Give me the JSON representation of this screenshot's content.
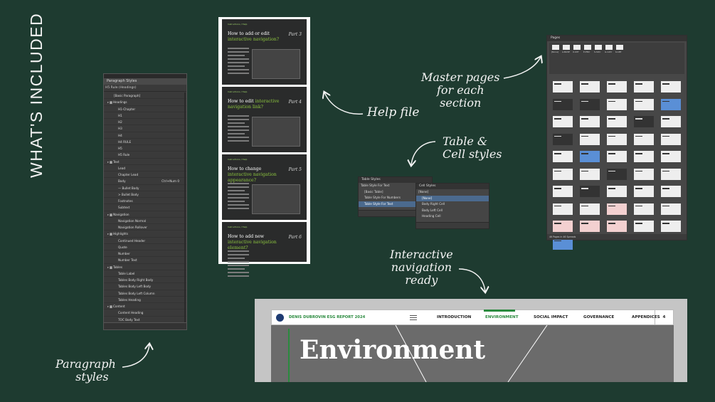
{
  "title": "WHAT'S INCLUDED",
  "annotations": {
    "paragraph": [
      "Paragraph",
      "styles"
    ],
    "help": "Help file",
    "table": [
      "Table &",
      "Cell styles"
    ],
    "master": [
      "Master pages",
      "for each",
      "section"
    ],
    "nav": [
      "Interactive",
      "navigation",
      "ready"
    ]
  },
  "paragraph_panel": {
    "title": "Paragraph Styles",
    "current": "H5 Rule (Headings)",
    "items": [
      {
        "label": "[Basic Paragraph]",
        "level": 1
      },
      {
        "label": "Headings",
        "level": 0
      },
      {
        "label": "H1-Chapter",
        "level": 2
      },
      {
        "label": "H1",
        "level": 2
      },
      {
        "label": "H2",
        "level": 2
      },
      {
        "label": "H3",
        "level": 2
      },
      {
        "label": "H4",
        "level": 2
      },
      {
        "label": "H4 RULE",
        "level": 2
      },
      {
        "label": "H5",
        "level": 2
      },
      {
        "label": "H5 Rule",
        "level": 2
      },
      {
        "label": "Text",
        "level": 0
      },
      {
        "label": "Lead",
        "level": 2
      },
      {
        "label": "Chapter Lead",
        "level": 2
      },
      {
        "label": "Body",
        "level": 2,
        "shortcut": "Ctrl+Num 0"
      },
      {
        "label": "— Bullet Body",
        "level": 2
      },
      {
        "label": "> Bullet Body",
        "level": 2
      },
      {
        "label": "Footnotes",
        "level": 2
      },
      {
        "label": "Subtext",
        "level": 2
      },
      {
        "label": "Navigation",
        "level": 0
      },
      {
        "label": "Navigation Normal",
        "level": 2
      },
      {
        "label": "Navigation Rollover",
        "level": 2
      },
      {
        "label": "Highlights",
        "level": 0
      },
      {
        "label": "Continued Header",
        "level": 2
      },
      {
        "label": "Quote",
        "level": 2
      },
      {
        "label": "Number",
        "level": 2
      },
      {
        "label": "Number Text",
        "level": 2
      },
      {
        "label": "Tables",
        "level": 0
      },
      {
        "label": "Table Label",
        "level": 2
      },
      {
        "label": "Tables Body Right Body",
        "level": 2
      },
      {
        "label": "Tables Body Left Body",
        "level": 2
      },
      {
        "label": "Tables Body Left Column",
        "level": 2
      },
      {
        "label": "Tables Heading",
        "level": 2
      },
      {
        "label": "Content",
        "level": 0
      },
      {
        "label": "Content Heading",
        "level": 2
      },
      {
        "label": "TOC Body Text",
        "level": 2
      }
    ]
  },
  "help_pages": [
    {
      "mini": "Instructions / Help",
      "title_a": "How to add or edit",
      "title_b": "interactive navigation?",
      "part": "Part 3"
    },
    {
      "mini": "Instructions / Help",
      "title_a": "How to edit",
      "title_b": "interactive navigation link?",
      "part": "Part 4"
    },
    {
      "mini": "Instructions / Help",
      "title_a": "How to change",
      "title_b": "interactive navigation appearance?",
      "part": "Part 5"
    },
    {
      "mini": "Instructions / Help",
      "title_a": "How to add new",
      "title_b": "interactive navigation element?",
      "part": "Part 6"
    }
  ],
  "table_panel": {
    "title": "Table Styles",
    "current": "Table Style For Text",
    "items": [
      "[Basic Table]",
      "Table Style For Numbers",
      "Table Style For Text"
    ],
    "selected": 2
  },
  "cell_panel": {
    "title": "Cell Styles",
    "current": "[None]",
    "items": [
      "[None]",
      "Body Right Cell",
      "Body Left Cell",
      "Heading Cell"
    ],
    "selected": 0
  },
  "pages_panel": {
    "title": "Pages",
    "masters": [
      "[None]",
      "A-BASE",
      "O-INT",
      "E-ENV",
      "S-SOC",
      "G-GOV",
      "K-APP"
    ],
    "footer": "46 Pages in 46 Spreads",
    "page_count": 46
  },
  "nav_demo": {
    "brand": "DENIS DUBROVIN ESG REPORT 2024",
    "items": [
      "INTRODUCTION",
      "ENVIRONMENT",
      "SOCIAL IMPACT",
      "GOVERNANCE",
      "APPENDICES"
    ],
    "active": 1,
    "page_number": "4",
    "heading": "Environment",
    "accent": "#2a8a3e"
  },
  "colors": {
    "background": "#1e3b30",
    "accent_green": "#8dc63f",
    "panel": "#3a3a3a"
  }
}
